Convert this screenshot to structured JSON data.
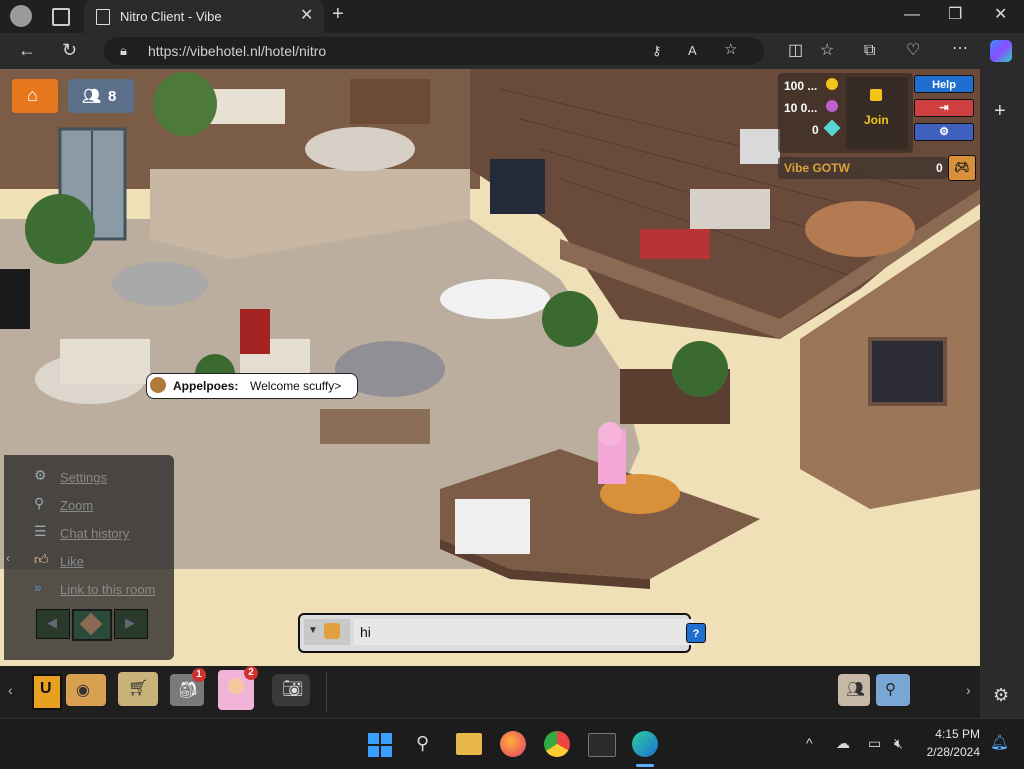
{
  "browser": {
    "tab_title": "Nitro Client - Vibe",
    "url": "https://vibehotel.nl/hotel/nitro"
  },
  "hotel": {
    "home_icon": "home-icon",
    "online_count": "8",
    "currency": [
      {
        "value": "100 ...",
        "icon": "gold-coin-icon"
      },
      {
        "value": "10 0...",
        "icon": "ducket-icon"
      },
      {
        "value": "0",
        "icon": "diamond-icon"
      }
    ],
    "join_label": "Join",
    "help_label": "Help",
    "gotw_label": "Vibe GOTW",
    "gotw_value": "0",
    "chat_bubble_user": "Appelpoes:",
    "chat_bubble_text": "Welcome scuffy>",
    "side_menu": [
      {
        "label": "Settings",
        "icon": "gear-icon"
      },
      {
        "label": "Zoom",
        "icon": "zoom-icon"
      },
      {
        "label": "Chat history",
        "icon": "chat-history-icon"
      },
      {
        "label": "Like",
        "icon": "thumbs-up-icon"
      },
      {
        "label": "Link to this room",
        "icon": "link-icon"
      }
    ],
    "chat_input_value": "hi",
    "chat_help": "?",
    "toolbar_badges": {
      "inventory": "1",
      "avatar": "2"
    }
  },
  "taskbar": {
    "time": "4:15 PM",
    "date": "2/28/2024"
  },
  "colors": {
    "home_button": "#e8781e",
    "help_button": "#1e6fd0",
    "exit_button": "#d04040",
    "settings_button": "#4060c0",
    "floor": "#b8a79a",
    "wall": "#8a6a52"
  }
}
